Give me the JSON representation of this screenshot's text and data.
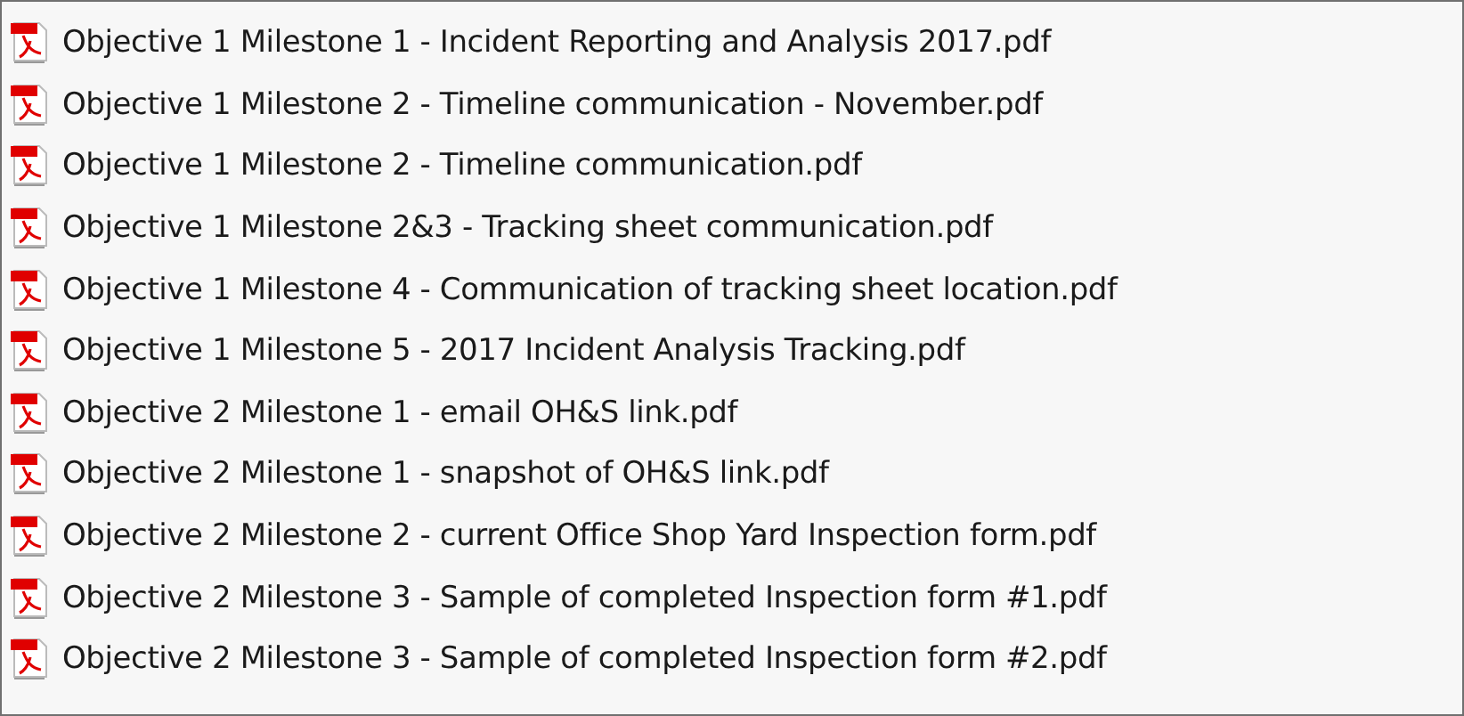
{
  "files": [
    {
      "name": "Objective 1 Milestone 1 - Incident Reporting and Analysis 2017.pdf"
    },
    {
      "name": "Objective 1 Milestone 2 - Timeline communication - November.pdf"
    },
    {
      "name": "Objective 1 Milestone 2 - Timeline communication.pdf"
    },
    {
      "name": "Objective 1 Milestone 2&3 - Tracking sheet communication.pdf"
    },
    {
      "name": "Objective 1 Milestone 4 - Communication of tracking sheet location.pdf"
    },
    {
      "name": "Objective 1 Milestone 5 - 2017 Incident Analysis Tracking.pdf"
    },
    {
      "name": "Objective 2 Milestone 1 - email OH&S link.pdf"
    },
    {
      "name": "Objective 2 Milestone 1 - snapshot of OH&S link.pdf"
    },
    {
      "name": "Objective 2 Milestone 2 - current Office Shop Yard Inspection form.pdf"
    },
    {
      "name": "Objective 2 Milestone 3 - Sample of completed Inspection form #1.pdf"
    },
    {
      "name": "Objective 2 Milestone 3 - Sample of completed Inspection form #2.pdf"
    }
  ]
}
